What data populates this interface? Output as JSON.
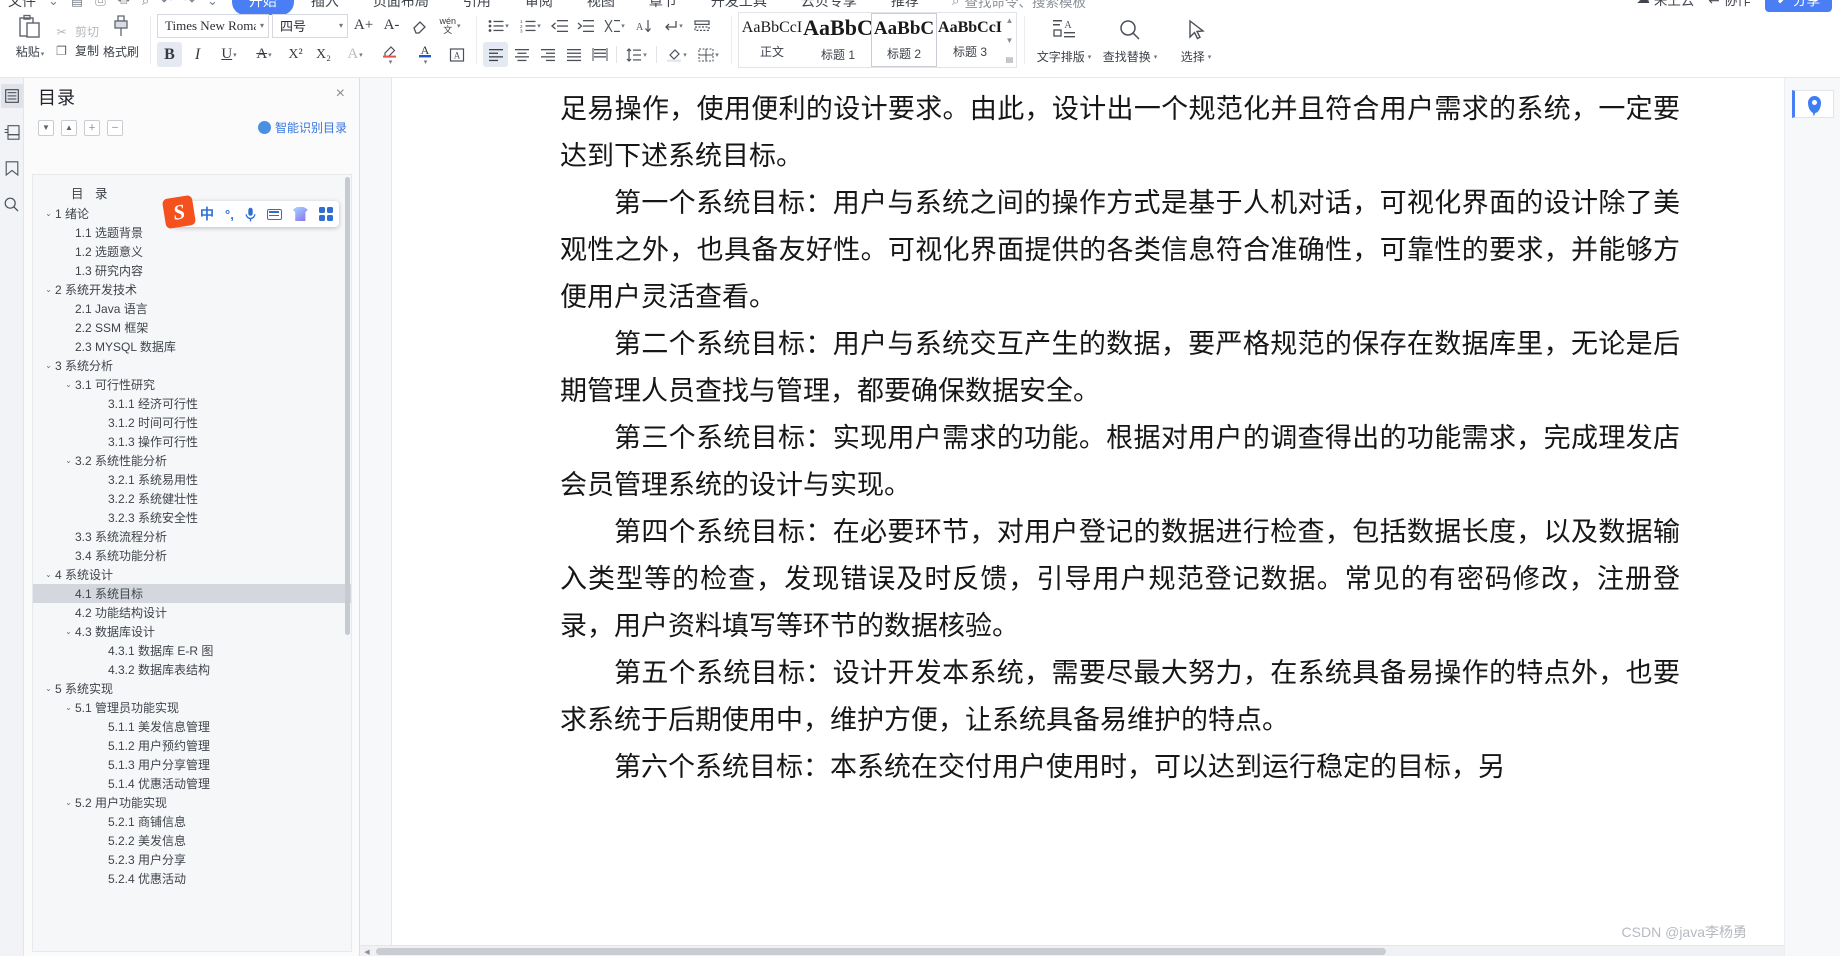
{
  "ribbon": {
    "file_menu": "文件",
    "quick_icons": [
      "save-icon",
      "print-icon",
      "print-preview-icon",
      "find-icon",
      "undo-icon",
      "redo-icon",
      "more-icon"
    ],
    "tabs": [
      {
        "label": "开始",
        "active": true
      },
      {
        "label": "插入",
        "active": false
      },
      {
        "label": "页面布局",
        "active": false
      },
      {
        "label": "引用",
        "active": false
      },
      {
        "label": "审阅",
        "active": false
      },
      {
        "label": "视图",
        "active": false
      },
      {
        "label": "章节",
        "active": false
      },
      {
        "label": "开发工具",
        "active": false
      },
      {
        "label": "云贝专享",
        "active": false
      },
      {
        "label": "推荐",
        "active": false
      }
    ],
    "search_placeholder": "查找命令、搜索模板",
    "right_actions": [
      {
        "label": "来上云",
        "icon": "cloud-icon"
      },
      {
        "label": "协作",
        "icon": "collaborate-icon"
      }
    ],
    "share_label": "分享",
    "clipboard": {
      "paste_label": "粘贴",
      "cut_label": "剪切",
      "copy_label": "复制",
      "format_painter_label": "格式刷"
    },
    "font": {
      "family_value": "Times New Roma",
      "size_value": "四号",
      "bold_label": "B",
      "italic_label": "I",
      "underline_label": "U",
      "superscript_label": "X²",
      "subscript_label": "X₂",
      "grow_label": "A+",
      "shrink_label": "A-",
      "clear_format_icon": "eraser-icon",
      "pinyin_label": "wén",
      "pinyin_sub": "文"
    },
    "styles": {
      "items": [
        {
          "preview": "AaBbCcI",
          "label": "正文",
          "size": 16,
          "weight": "normal",
          "selected": false
        },
        {
          "preview": "AaBbC",
          "label": "标题 1",
          "size": 22,
          "weight": "bold",
          "selected": false
        },
        {
          "preview": "AaBbC",
          "label": "标题 2",
          "size": 19,
          "weight": "bold",
          "selected": true
        },
        {
          "preview": "AaBbCcI",
          "label": "标题 3",
          "size": 16,
          "weight": "bold",
          "selected": false
        }
      ]
    },
    "tools": [
      {
        "label": "文字排版",
        "icon": "text-layout-icon"
      },
      {
        "label": "查找替换",
        "icon": "search-icon"
      },
      {
        "label": "选择",
        "icon": "cursor-select-icon"
      }
    ]
  },
  "rail": {
    "items": [
      {
        "name": "toc-icon",
        "active": true
      },
      {
        "name": "thumbnail-icon",
        "active": false
      },
      {
        "name": "bookmark-icon",
        "active": false
      },
      {
        "name": "search-icon",
        "active": false
      }
    ]
  },
  "nav": {
    "title": "目录",
    "close_label": "×",
    "tools": [
      "chevron-down-icon",
      "chevron-up-icon",
      "expand-all-icon",
      "collapse-all-icon"
    ],
    "smart_label": "智能识别目录",
    "toc_heading": "目 录",
    "items": [
      {
        "level": 1,
        "text": "1  绪论",
        "chevron": "v",
        "selected": false
      },
      {
        "level": 2,
        "text": "1.1  选题背景",
        "chevron": "",
        "selected": false
      },
      {
        "level": 2,
        "text": "1.2  选题意义",
        "chevron": "",
        "selected": false
      },
      {
        "level": 2,
        "text": "1.3  研究内容",
        "chevron": "",
        "selected": false
      },
      {
        "level": 1,
        "text": "2  系统开发技术",
        "chevron": "v",
        "selected": false
      },
      {
        "level": 2,
        "text": "2.1 Java 语言",
        "chevron": "",
        "selected": false
      },
      {
        "level": 2,
        "text": "2.2 SSM 框架",
        "chevron": "",
        "selected": false
      },
      {
        "level": 2,
        "text": "2.3 MYSQL 数据库",
        "chevron": "",
        "selected": false
      },
      {
        "level": 1,
        "text": "3  系统分析",
        "chevron": "v",
        "selected": false
      },
      {
        "level": 2,
        "text": "3.1 可行性研究",
        "chevron": "v",
        "selected": false
      },
      {
        "level": 3,
        "text": "3.1.1 经济可行性",
        "chevron": "",
        "selected": false
      },
      {
        "level": 3,
        "text": "3.1.2 时间可行性",
        "chevron": "",
        "selected": false
      },
      {
        "level": 3,
        "text": "3.1.3 操作可行性",
        "chevron": "",
        "selected": false
      },
      {
        "level": 2,
        "text": "3.2 系统性能分析",
        "chevron": "v",
        "selected": false
      },
      {
        "level": 3,
        "text": "3.2.1 系统易用性",
        "chevron": "",
        "selected": false
      },
      {
        "level": 3,
        "text": "3.2.2 系统健壮性",
        "chevron": "",
        "selected": false
      },
      {
        "level": 3,
        "text": "3.2.3 系统安全性",
        "chevron": "",
        "selected": false
      },
      {
        "level": 2,
        "text": "3.3  系统流程分析",
        "chevron": "",
        "selected": false
      },
      {
        "level": 2,
        "text": "3.4 系统功能分析",
        "chevron": "",
        "selected": false
      },
      {
        "level": 1,
        "text": "4  系统设计",
        "chevron": "v",
        "selected": false
      },
      {
        "level": 2,
        "text": "4.1 系统目标",
        "chevron": "",
        "selected": true
      },
      {
        "level": 2,
        "text": "4.2 功能结构设计",
        "chevron": "",
        "selected": false
      },
      {
        "level": 2,
        "text": "4.3 数据库设计",
        "chevron": "v",
        "selected": false
      },
      {
        "level": 3,
        "text": "4.3.1 数据库 E-R 图",
        "chevron": "",
        "selected": false
      },
      {
        "level": 3,
        "text": "4.3.2  数据库表结构",
        "chevron": "",
        "selected": false
      },
      {
        "level": 1,
        "text": "5  系统实现",
        "chevron": "v",
        "selected": false
      },
      {
        "level": 2,
        "text": "5.1  管理员功能实现",
        "chevron": "v",
        "selected": false
      },
      {
        "level": 3,
        "text": "5.1.1  美发信息管理",
        "chevron": "",
        "selected": false
      },
      {
        "level": 3,
        "text": "5.1.2  用户预约管理",
        "chevron": "",
        "selected": false
      },
      {
        "level": 3,
        "text": "5.1.3  用户分享管理",
        "chevron": "",
        "selected": false
      },
      {
        "level": 3,
        "text": "5.1.4  优惠活动管理",
        "chevron": "",
        "selected": false
      },
      {
        "level": 2,
        "text": "5.2  用户功能实现",
        "chevron": "v",
        "selected": false
      },
      {
        "level": 3,
        "text": "5.2.1  商铺信息",
        "chevron": "",
        "selected": false
      },
      {
        "level": 3,
        "text": "5.2.2  美发信息",
        "chevron": "",
        "selected": false
      },
      {
        "level": 3,
        "text": "5.2.3  用户分享",
        "chevron": "",
        "selected": false
      },
      {
        "level": 3,
        "text": "5.2.4  优惠活动",
        "chevron": "",
        "selected": false
      }
    ]
  },
  "ime": {
    "logo": "S",
    "mode_label": "中",
    "punct_label": "°,",
    "icons": [
      "microphone-icon",
      "keyboard-icon",
      "skin-icon",
      "apps-icon"
    ]
  },
  "document": {
    "paragraphs": [
      {
        "indent": false,
        "text": "足易操作，使用便利的设计要求。由此，设计出一个规范化并且符合用户需求的系统，一定要达到下述系统目标。"
      },
      {
        "indent": true,
        "text": "第一个系统目标：用户与系统之间的操作方式是基于人机对话，可视化界面的设计除了美观性之外，也具备友好性。可视化界面提供的各类信息符合准确性，可靠性的要求，并能够方便用户灵活查看。"
      },
      {
        "indent": true,
        "text": "第二个系统目标：用户与系统交互产生的数据，要严格规范的保存在数据库里，无论是后期管理人员查找与管理，都要确保数据安全。"
      },
      {
        "indent": true,
        "text": "第三个系统目标：实现用户需求的功能。根据对用户的调查得出的功能需求，完成理发店会员管理系统的设计与实现。"
      },
      {
        "indent": true,
        "text": "第四个系统目标：在必要环节，对用户登记的数据进行检查，包括数据长度，以及数据输入类型等的检查，发现错误及时反馈，引导用户规范登记数据。常见的有密码修改，注册登录，用户资料填写等环节的数据核验。"
      },
      {
        "indent": true,
        "text": "第五个系统目标：设计开发本系统，需要尽最大努力，在系统具备易操作的特点外，也要求系统于后期使用中，维护方便，让系统具备易维护的特点。"
      },
      {
        "indent": true,
        "text": "第六个系统目标：本系统在交付用户使用时，可以达到运行稳定的目标，另"
      }
    ],
    "watermark": "CSDN @java李杨勇"
  },
  "colors": {
    "accent": "#4a7ef4",
    "tab_active_bg": "#4a7ef4",
    "toc_selected_bg": "#d4d8de",
    "ime_logo": "#f4511e",
    "link_blue": "#3576e0"
  }
}
